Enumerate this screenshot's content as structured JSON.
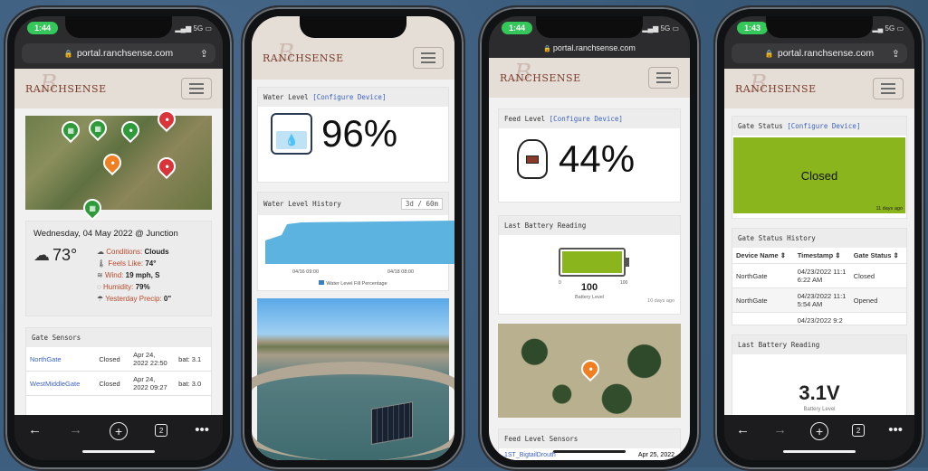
{
  "phone1": {
    "time": "1:44",
    "url": "portal.ranchsense.com",
    "logo": "RANCHSENSE",
    "weather": {
      "date_line": "Wednesday, 04 May 2022 @ Junction",
      "temp": "73°",
      "conditions_label": "Conditions:",
      "conditions_value": "Clouds",
      "feels_label": "Feels Like:",
      "feels_value": "74°",
      "wind_label": "Wind:",
      "wind_value": "19 mph, S",
      "humidity_label": "Humidity:",
      "humidity_value": "79%",
      "precip_label": "Yesterday Precip:",
      "precip_value": "0\""
    },
    "gate_sensors": {
      "title": "Gate Sensors",
      "rows": [
        {
          "name": "NorthGate",
          "status": "Closed",
          "date": "Apr 24, 2022 22:50",
          "bat": "bat: 3.1"
        },
        {
          "name": "WestMiddleGate",
          "status": "Closed",
          "date": "Apr 24, 2022 09:27",
          "bat": "bat: 3.0"
        }
      ]
    },
    "tabs_count": "2"
  },
  "phone2": {
    "water_level_title": "Water Level",
    "configure": "[Configure Device]",
    "water_pct": "96%",
    "history_title": "Water Level History",
    "history_range": "3d / 60m",
    "x_tick_1": "04/16 09:00",
    "x_tick_2": "04/18 08:00",
    "legend": "Water Level Fill Percentage"
  },
  "phone3": {
    "time": "1:44",
    "url": "portal.ranchsense.com",
    "logo": "RANCHSENSE",
    "feed_title": "Feed Level",
    "configure": "[Configure Device]",
    "feed_pct": "44%",
    "battery_title": "Last Battery Reading",
    "battery_value": "100",
    "battery_min": "0",
    "battery_max": "100",
    "battery_label": "Battery Level",
    "battery_ago": "10 days ago",
    "battery_fill": 1.0,
    "feed_sensors_title": "Feed Level Sensors",
    "feed_sensor_partial": "1ST_BigtailDrouth",
    "feed_sensor_date": "Apr 25, 2022"
  },
  "phone4": {
    "time": "1:43",
    "url": "portal.ranchsense.com",
    "logo": "RANCHSENSE",
    "gate_status_title": "Gate Status",
    "configure": "[Configure Device]",
    "gate_state": "Closed",
    "gate_ago": "11 days ago",
    "history_title": "Gate Status History",
    "col_device": "Device Name",
    "col_timestamp": "Timestamp",
    "col_status": "Gate Status",
    "rows": [
      {
        "device": "NorthGate",
        "ts": "04/23/2022 11:1 6:22 AM",
        "status": "Closed"
      },
      {
        "device": "NorthGate",
        "ts": "04/23/2022 11:1 5:54 AM",
        "status": "Opened"
      }
    ],
    "row_partial": "04/23/2022 9:2",
    "battery_title": "Last Battery Reading",
    "battery_value": "3.1V",
    "battery_label": "Battery Level",
    "tabs_count": "2"
  },
  "colors": {
    "accent_green": "#8bb51c",
    "water_blue": "#5cb3e0",
    "link": "#3b63c4"
  }
}
